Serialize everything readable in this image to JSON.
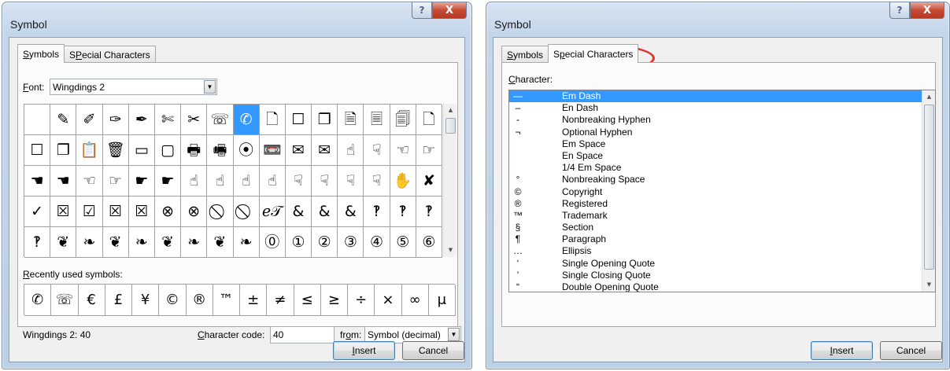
{
  "left_dialog": {
    "title": "Symbol",
    "help_glyph": "?",
    "close_glyph": "X",
    "tabs": [
      {
        "label": "Symbols",
        "underline": "S",
        "rest": "ymbols"
      },
      {
        "label": "Special Characters",
        "underline": "P",
        "pre": "S",
        "rest": "ecial Characters"
      }
    ],
    "font_label": {
      "underline": "F",
      "rest": "ont:"
    },
    "font_value": "Wingdings 2",
    "symbol_rows": [
      [
        " ",
        "✎",
        "✐",
        "✑",
        "✒",
        "✄",
        "✂",
        "☏",
        "✆",
        "🗋",
        "☐",
        "❐",
        "🗎",
        "🗏",
        "🗐",
        "🗋"
      ],
      [
        "☐",
        "❐",
        "📋",
        "🗑",
        "▭",
        "▢",
        "🖶",
        "🖷",
        "⦿",
        "📼",
        "✉",
        "✉",
        "☝",
        "☟",
        "☜",
        "☞"
      ],
      [
        "☚",
        "☚",
        "☜",
        "☞",
        "☛",
        "☛",
        "☝",
        "☝",
        "☝",
        "☝",
        "☟",
        "☟",
        "☟",
        "☟",
        "✋",
        "✘"
      ],
      [
        "✓",
        "☒",
        "☑",
        "☒",
        "☒",
        "⊗",
        "⊗",
        "⃠",
        "⃠",
        "ℯ𝒯",
        "&",
        "&",
        "&",
        "‽",
        "‽",
        "‽"
      ],
      [
        "‽",
        "❦",
        "❧",
        "❦",
        "❧",
        "❦",
        "❧",
        "❦",
        "❧",
        "⓪",
        "①",
        "②",
        "③",
        "④",
        "⑤",
        "⑥"
      ]
    ],
    "selected_cell": "✆",
    "recent_label": {
      "underline": "R",
      "rest": "ecently used symbols:"
    },
    "recent_symbols": [
      "✆",
      "☏",
      "€",
      "£",
      "¥",
      "©",
      "®",
      "™",
      "±",
      "≠",
      "≤",
      "≥",
      "÷",
      "×",
      "∞",
      "μ"
    ],
    "status_text": "Wingdings 2: 40",
    "char_code_label": {
      "underline": "C",
      "rest": "haracter code:"
    },
    "char_code_value": "40",
    "from_label": {
      "pre": "fr",
      "underline": "o",
      "rest": "m:"
    },
    "from_value": "Symbol (decimal)",
    "insert_label": {
      "underline": "I",
      "rest": "nsert"
    },
    "cancel_label": "Cancel"
  },
  "right_dialog": {
    "title": "Symbol",
    "help_glyph": "?",
    "close_glyph": "X",
    "tabs": [
      {
        "label": "Symbols",
        "underline": "S",
        "rest": "ymbols"
      },
      {
        "label": "Special Characters",
        "pre": "S",
        "underline": "p",
        "rest": "ecial Characters"
      }
    ],
    "character_label": {
      "underline": "C",
      "rest": "haracter:"
    },
    "characters": [
      {
        "symbol": "—",
        "name": "Em Dash"
      },
      {
        "symbol": "–",
        "name": "En Dash"
      },
      {
        "symbol": "-",
        "name": "Nonbreaking Hyphen"
      },
      {
        "symbol": "¬",
        "name": "Optional Hyphen"
      },
      {
        "symbol": "",
        "name": "Em Space"
      },
      {
        "symbol": "",
        "name": "En Space"
      },
      {
        "symbol": "",
        "name": "1/4 Em Space"
      },
      {
        "symbol": "°",
        "name": "Nonbreaking Space"
      },
      {
        "symbol": "©",
        "name": "Copyright"
      },
      {
        "symbol": "®",
        "name": "Registered"
      },
      {
        "symbol": "™",
        "name": "Trademark"
      },
      {
        "symbol": "§",
        "name": "Section"
      },
      {
        "symbol": "¶",
        "name": "Paragraph"
      },
      {
        "symbol": "…",
        "name": "Ellipsis"
      },
      {
        "symbol": "‘",
        "name": "Single Opening Quote"
      },
      {
        "symbol": "’",
        "name": "Single Closing Quote"
      },
      {
        "symbol": "“",
        "name": "Double Opening Quote"
      }
    ],
    "selected_character": "Em Dash",
    "insert_label": {
      "underline": "I",
      "rest": "nsert"
    },
    "cancel_label": "Cancel",
    "annotation_color": "#e0312a"
  },
  "colors": {
    "selection": "#3399ff",
    "close_button": "#c64b35"
  }
}
